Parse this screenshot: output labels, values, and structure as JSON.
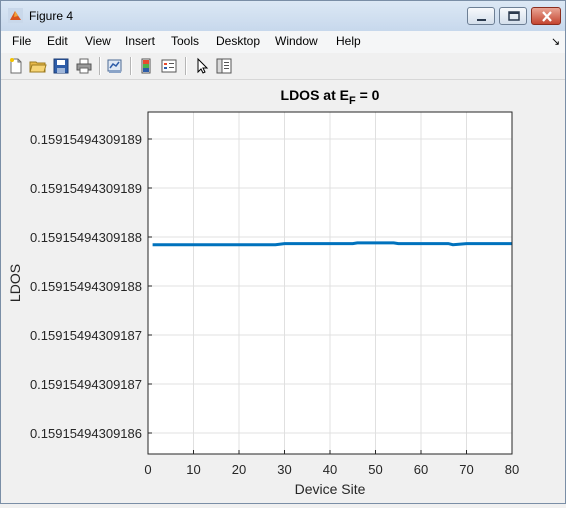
{
  "window": {
    "title": "Figure 4"
  },
  "menu": {
    "items": [
      "File",
      "Edit",
      "View",
      "Insert",
      "Tools",
      "Desktop",
      "Window",
      "Help"
    ]
  },
  "toolbar": {
    "icons": [
      "new-figure-icon",
      "open-file-icon",
      "save-icon",
      "print-icon",
      "link-plot-icon",
      "insert-colorbar-icon",
      "insert-legend-icon",
      "edit-plot-icon",
      "plot-browser-icon"
    ]
  },
  "chart_data": {
    "type": "line",
    "title_main": "LDOS at E",
    "title_sub": "F",
    "title_tail": " = 0",
    "xlabel": "Device Site",
    "ylabel": "LDOS",
    "xlim": [
      0,
      80
    ],
    "x_ticks": [
      0,
      10,
      20,
      30,
      40,
      50,
      60,
      70,
      80
    ],
    "y_ticks": [
      "0.15915494309186",
      "0.15915494309187",
      "0.15915494309187",
      "0.15915494309188",
      "0.15915494309188",
      "0.15915494309189",
      "0.15915494309189"
    ],
    "grid": true,
    "line_color": "#0072bd",
    "series": [
      {
        "x": [
          1,
          7,
          14,
          21,
          28,
          30,
          35,
          40,
          45,
          46,
          50,
          54,
          55,
          60,
          66,
          67,
          70,
          75,
          80
        ],
        "y": [
          0.1591549430918805,
          0.1591549430918805,
          0.1591549430918805,
          0.1591549430918805,
          0.1591549430918805,
          0.1591549430918806,
          0.1591549430918806,
          0.1591549430918806,
          0.1591549430918806,
          0.1591549430918807,
          0.1591549430918807,
          0.1591549430918807,
          0.1591549430918806,
          0.1591549430918806,
          0.1591549430918806,
          0.1591549430918805,
          0.1591549430918806,
          0.1591549430918806,
          0.1591549430918806
        ]
      }
    ]
  }
}
